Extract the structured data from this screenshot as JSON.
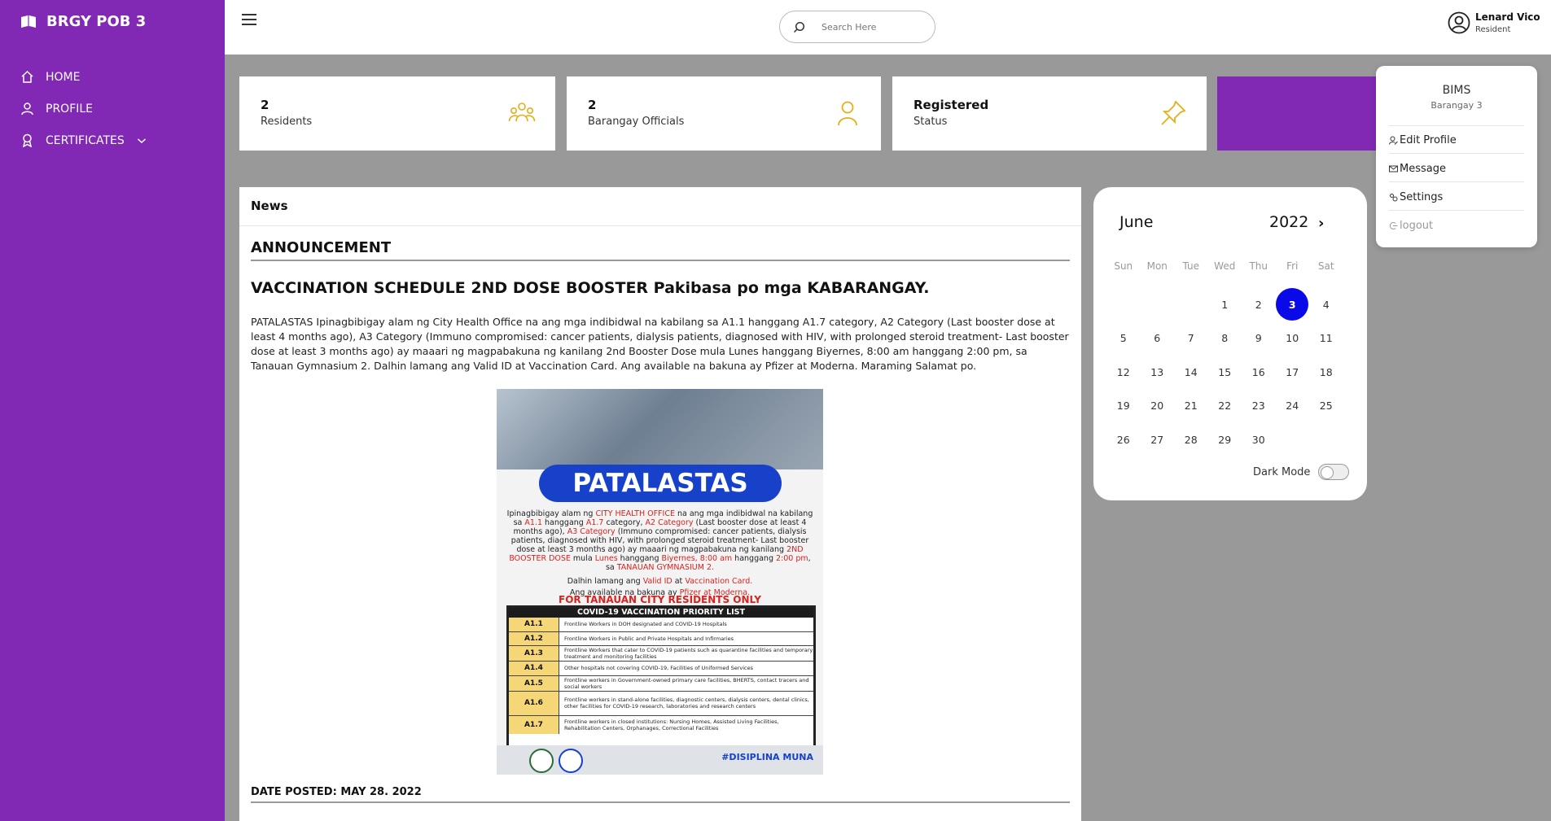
{
  "sidebar": {
    "brand": "BRGY POB 3",
    "items": [
      {
        "label": "HOME",
        "icon": "home-icon"
      },
      {
        "label": "PROFILE",
        "icon": "user-icon"
      },
      {
        "label": "CERTIFICATES",
        "icon": "award-icon"
      }
    ]
  },
  "header": {
    "search_placeholder": "Search Here",
    "user_name": "Lenard Vico",
    "user_role": "Resident"
  },
  "stats": [
    {
      "value": "2",
      "label": "Residents",
      "icon": "users-icon"
    },
    {
      "value": "2",
      "label": "Barangay Officials",
      "icon": "official-icon"
    },
    {
      "value": "Registered",
      "label": "Status",
      "icon": "pin-icon"
    }
  ],
  "news": {
    "header": "News",
    "section": "ANNOUNCEMENT",
    "headline": "VACCINATION SCHEDULE 2ND DOSE BOOSTER Pakibasa po mga KABARANGAY.",
    "body": "PATALASTAS Ipinagbibigay alam ng City Health Office na ang mga indibidwal na kabilang sa A1.1 hanggang A1.7 category, A2 Category (Last booster dose at least 4 months ago), A3 Category (Immuno compromised: cancer patients, dialysis patients, diagnosed with HIV, with prolonged steroid treatment- Last booster dose at least 3 months ago) ay maaari ng magpabakuna ng kanilang 2nd Booster Dose mula Lunes hanggang Biyernes, 8:00 am hanggang 2:00 pm, sa Tanauan Gymnasium 2. Dalhin lamang ang Valid ID at Vaccination Card. Ang available na bakuna ay Pfizer at Moderna. Maraming Salamat po.",
    "date_posted": "DATE POSTED: MAY 28. 2022",
    "poster": {
      "title": "PATALASTAS",
      "text_1a": "Ipinagbibigay alam ng ",
      "text_1b": "CITY HEALTH OFFICE",
      "text_1c": " na ang mga indibidwal na kabilang sa ",
      "text_1d": "A1.1",
      "text_1e": " hanggang ",
      "text_1f": "A1.7",
      "text_1g": " category, ",
      "text_1h": "A2 Category",
      "text_1i": " (Last booster dose at least 4 months ago), ",
      "text_1j": "A3 Category",
      "text_1k": " (Immuno compromised: cancer patients, dialysis patients, diagnosed with HIV, with prolonged steroid treatment- Last booster dose at least 3 months ago) ay maaari ng magpabakuna ng kanilang ",
      "text_1l": "2ND BOOSTER DOSE",
      "text_1m": " mula ",
      "text_1n": "Lunes",
      "text_1o": " hanggang ",
      "text_1p": "Biyernes, 8:00 am",
      "text_1q": " hanggang ",
      "text_1r": "2:00 pm",
      "text_1s": ", sa ",
      "text_1t": "TANAUAN GYMNASIUM 2.",
      "text_2a": "Dalhin lamang ang ",
      "text_2b": "Valid ID",
      "text_2c": " at ",
      "text_2d": "Vaccination Card.",
      "text_3a": "Ang available na bakuna ay ",
      "text_3b": "Pfizer at Moderna.",
      "residents_only": "FOR TANAUAN CITY RESIDENTS ONLY",
      "list_title": "COVID-19 VACCINATION PRIORITY LIST",
      "priority": [
        {
          "code": "A1.1",
          "desc": "Frontline Workers in DOH designated and COVID-19 Hospitals"
        },
        {
          "code": "A1.2",
          "desc": "Frontline Workers in Public and Private Hospitals and Infirmaries"
        },
        {
          "code": "A1.3",
          "desc": "Frontline Workers that cater to COVID-19 patients such as quarantine facilities and temporary treatment and monitoring facilities"
        },
        {
          "code": "A1.4",
          "desc": "Other hospitals not covering COVID-19, Facilities of Uniformed Services"
        },
        {
          "code": "A1.5",
          "desc": "Frontline workers in Government-owned primary care facilities, BHERTS, contact tracers and social workers"
        },
        {
          "code": "A1.6",
          "desc": "Frontline workers in stand-alone facilities, diagnostic centers, dialysis centers, dental clinics, other facilities for COVID-19 research, laboratories and research centers"
        },
        {
          "code": "A1.7",
          "desc": "Frontline workers in closed institutions: Nursing Homes, Assisted Living Facilities, Rehabilitation Centers, Orphanages, Correctional Facilities"
        }
      ],
      "footer_text": "#DISIPLINA MUNA"
    }
  },
  "calendar": {
    "month": "June",
    "year": "2022",
    "next": "›",
    "weekdays": [
      "Sun",
      "Mon",
      "Tue",
      "Wed",
      "Thu",
      "Fri",
      "Sat"
    ],
    "leading_blanks": 3,
    "days": 30,
    "selected": 3,
    "selected_color": "#0a0ae8",
    "dark_mode_label": "Dark Mode"
  },
  "dropdown": {
    "title": "BIMS",
    "subtitle": "Barangay 3",
    "items": [
      {
        "label": "Edit Profile",
        "icon": "user-edit-icon"
      },
      {
        "label": "Message",
        "icon": "mail-icon"
      },
      {
        "label": "Settings",
        "icon": "settings-icon"
      },
      {
        "label": "logout",
        "icon": "logout-icon"
      }
    ]
  },
  "colors": {
    "sidebar": "#8128b4",
    "accent_icon": "#e3b019",
    "background": "#999999"
  }
}
